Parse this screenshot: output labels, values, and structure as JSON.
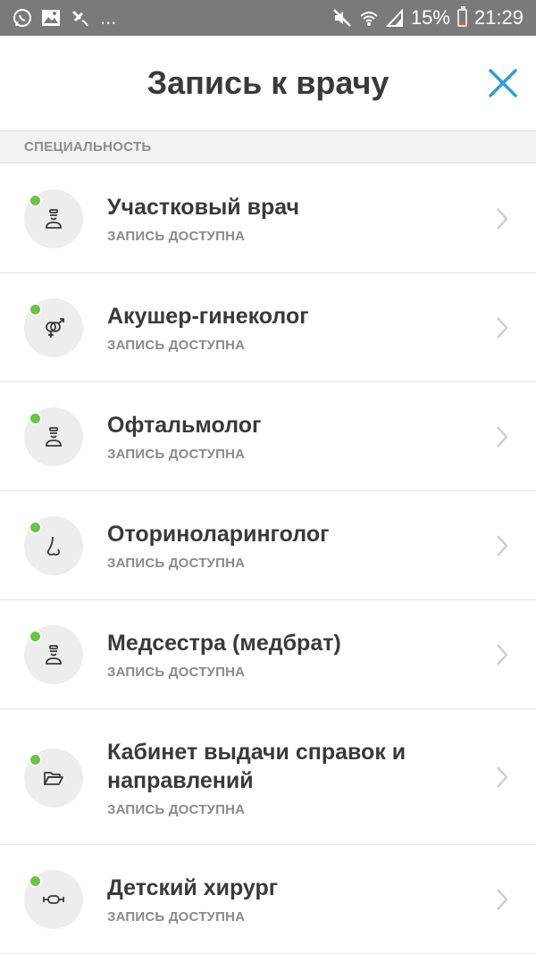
{
  "status_bar": {
    "left_icons": [
      "whatsapp-icon",
      "gallery-icon",
      "satellite-icon"
    ],
    "more": "...",
    "battery_percent": "15%",
    "battery_level": 0.15,
    "time": "21:29",
    "right_icons": [
      "mute-icon",
      "wifi-icon",
      "signal-icon",
      "battery-icon"
    ]
  },
  "header": {
    "title": "Запись к врачу",
    "close_icon": "close-icon"
  },
  "section": {
    "title": "СПЕЦИАЛЬНОСТЬ"
  },
  "colors": {
    "accent": "#2a9fd8",
    "status_available": "#6cc24a",
    "status_bar_bg": "#7a7a7a",
    "text_primary": "#3a3a3a",
    "text_secondary": "#8a8a8a"
  },
  "specialties": [
    {
      "title": "Участковый врач",
      "status": "ЗАПИСЬ ДОСТУПНА",
      "icon": "doctor-icon"
    },
    {
      "title": "Акушер-гинеколог",
      "status": "ЗАПИСЬ ДОСТУПНА",
      "icon": "gender-icon"
    },
    {
      "title": "Офтальмолог",
      "status": "ЗАПИСЬ ДОСТУПНА",
      "icon": "doctor-icon"
    },
    {
      "title": "Оториноларинголог",
      "status": "ЗАПИСЬ ДОСТУПНА",
      "icon": "nose-icon"
    },
    {
      "title": "Медсестра (медбрат)",
      "status": "ЗАПИСЬ ДОСТУПНА",
      "icon": "doctor-icon"
    },
    {
      "title": "Кабинет выдачи справок и направлений",
      "status": "ЗАПИСЬ ДОСТУПНА",
      "icon": "folder-icon"
    },
    {
      "title": "Детский хирург",
      "status": "ЗАПИСЬ ДОСТУПНА",
      "icon": "bone-icon"
    }
  ]
}
